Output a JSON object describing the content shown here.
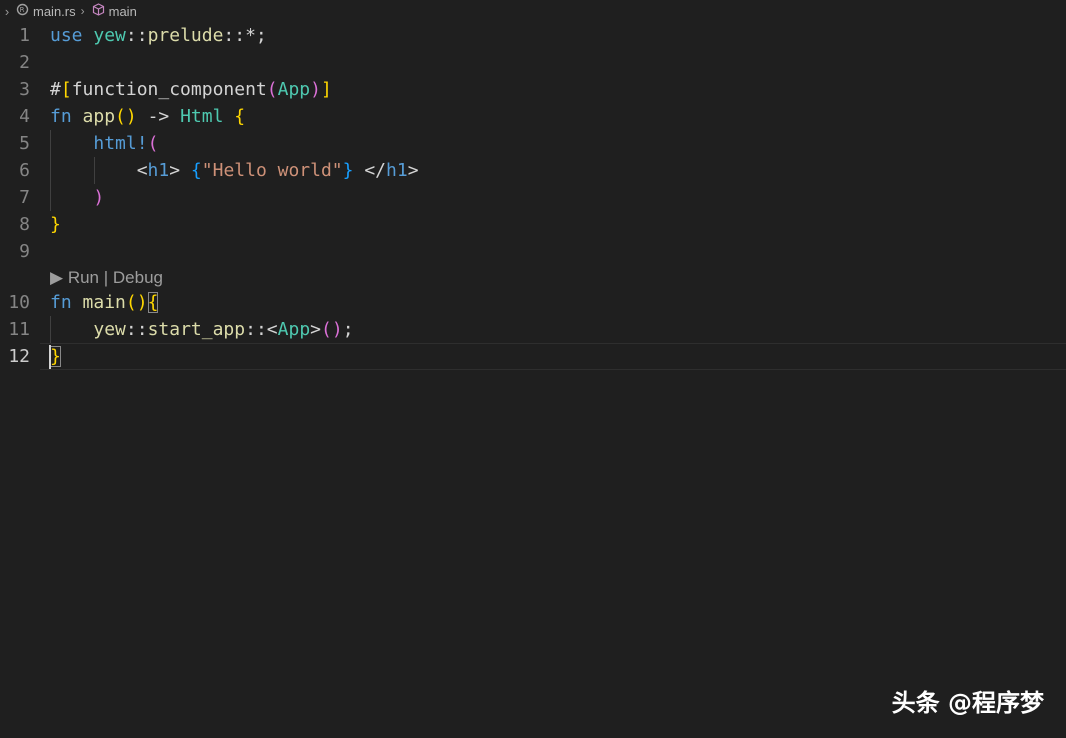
{
  "breadcrumb": {
    "file": "main.rs",
    "symbol": "main"
  },
  "editor": {
    "line_numbers": [
      "1",
      "2",
      "3",
      "4",
      "5",
      "6",
      "7",
      "8",
      "9",
      "10",
      "11",
      "12"
    ],
    "codelens": {
      "run_glyph": "▶",
      "run": "Run",
      "separator": "|",
      "debug": "Debug"
    },
    "current_line": "12",
    "lines": {
      "l1": {
        "kw": "use",
        "ns": "yew",
        "sep": "::",
        "ns2": "prelude",
        "rest": "::*;"
      },
      "l3": {
        "hash": "#",
        "ob": "[",
        "attr": "function_component",
        "op": "(",
        "ty": "App",
        "cp": ")",
        "cb": "]"
      },
      "l4": {
        "kw": "fn",
        "name": "app",
        "parens": "()",
        "arrow": " -> ",
        "ty": "Html",
        "brace": "{"
      },
      "l5": {
        "mac": "html",
        "bang": "!",
        "paren": "("
      },
      "l6": {
        "lt": "<",
        "tag1": "h1",
        "gt": ">",
        "ob": "{",
        "str": "\"Hello world\"",
        "cb": "}",
        "lt2": "</",
        "tag2": "h1",
        "gt2": ">"
      },
      "l7": {
        "paren": ")"
      },
      "l8": {
        "brace": "}"
      },
      "l10": {
        "kw": "fn",
        "name": "main",
        "parens": "()",
        "brace": "{"
      },
      "l11": {
        "ns": "yew",
        "sep": "::",
        "fn": "start_app",
        "sep2": "::",
        "lt": "<",
        "ty": "App",
        "gt": ">",
        "parens": "()",
        "semi": ";"
      },
      "l12": {
        "brace": "}"
      }
    }
  },
  "watermark": "头条 @程序梦",
  "colors": {
    "background": "#1f1f1f",
    "keyword": "#569cd6",
    "type": "#4ec9b0",
    "function": "#dcdcaa",
    "string": "#ce9178",
    "bracket_gold": "#ffd700",
    "bracket_orchid": "#da70d6",
    "bracket_blue": "#179fff"
  }
}
